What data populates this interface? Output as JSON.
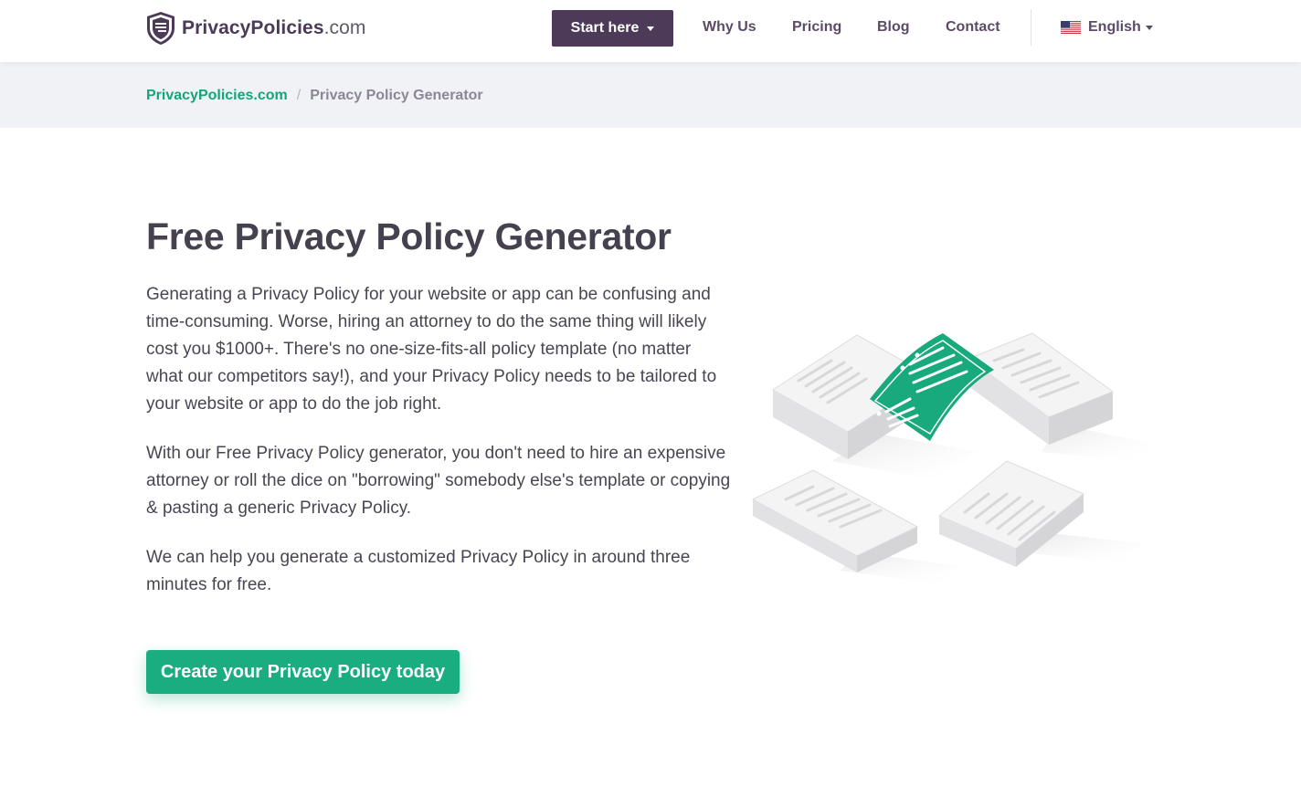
{
  "header": {
    "logo": {
      "brand": "PrivacyPolicies",
      "tld": ".com"
    },
    "start_button": "Start here",
    "nav": [
      "Why Us",
      "Pricing",
      "Blog",
      "Contact"
    ],
    "language": "English"
  },
  "breadcrumb": {
    "home": "PrivacyPolicies.com",
    "separator": "/",
    "current": "Privacy Policy Generator"
  },
  "main": {
    "title": "Free Privacy Policy Generator",
    "paragraphs": [
      "Generating a Privacy Policy for your website or app can be confusing and time-consuming. Worse, hiring an attorney to do the same thing will likely cost you $1000+. There's no one-size-fits-all policy template (no matter what our competitors say!), and your Privacy Policy needs to be tailored to your website or app to do the job right.",
      "With our Free Privacy Policy generator, you don't need to hire an expensive attorney or roll the dice on \"borrowing\" somebody else's template or copying & pasting a generic Privacy Policy.",
      "We can help you generate a customized Privacy Policy in around three minutes for free."
    ],
    "cta": "Create your Privacy Policy today"
  },
  "colors": {
    "brand_purple": "#4c3a58",
    "accent_green": "#1aad7f",
    "breadcrumb_band": "#f1f2f6"
  },
  "icons": [
    "shield-logo-icon",
    "caret-down-icon",
    "us-flag-icon",
    "document-stacks-illustration"
  ]
}
